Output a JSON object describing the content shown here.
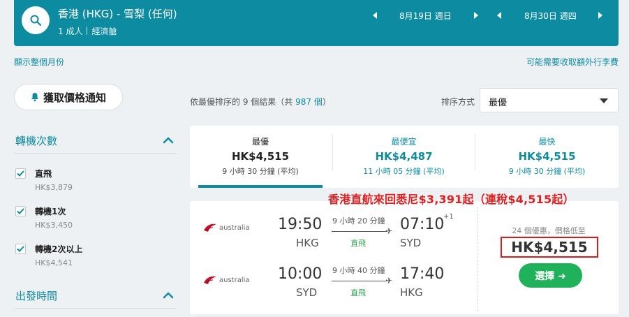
{
  "header": {
    "route": "香港 (HKG) - 雪梨 (任何)",
    "passengers": "1 成人",
    "cabin": "經濟艙",
    "depart_date": "8月19日 週日",
    "return_date": "8月30日 週四"
  },
  "links": {
    "show_month": "顯示整個月份",
    "baggage_fees": "可能需要收取額外行李費"
  },
  "sidebar": {
    "price_alert_label": "獲取價格通知",
    "stops_title": "轉機次數",
    "stops": [
      {
        "label": "直飛",
        "price": "HK$3,879",
        "checked": true
      },
      {
        "label": "轉機1次",
        "price": "HK$3,450",
        "checked": true
      },
      {
        "label": "轉機2次以上",
        "price": "HK$4,541",
        "checked": true
      }
    ],
    "departure_title": "出發時間"
  },
  "results": {
    "prefix": "依最優排序的 9 個結果（共 ",
    "total": "987 個",
    "suffix": "）",
    "sort_label": "排序方式",
    "sort_value": "最優"
  },
  "tabs": [
    {
      "title": "最優",
      "price": "HK$4,515",
      "duration": "9 小時 30 分鐘 (平均)",
      "selected": true
    },
    {
      "title": "最便宜",
      "price": "HK$4,487",
      "duration": "11 小時 05 分鐘 (平均)",
      "selected": false
    },
    {
      "title": "最快",
      "price": "HK$4,515",
      "duration": "9 小時 30 分鐘 (平均)",
      "selected": false
    }
  ],
  "promo_text": "香港直航來回悉尼$3,391起（連稅$4,515起）",
  "flight": {
    "legs": [
      {
        "airline": "australia",
        "depart_time": "19:50",
        "depart_code": "HKG",
        "duration": "9 小時 20 分鐘",
        "stops": "直飛",
        "arrive_time": "07:10",
        "day_offset": "+1",
        "arrive_code": "SYD"
      },
      {
        "airline": "australia",
        "depart_time": "10:00",
        "depart_code": "SYD",
        "duration": "9 小時 40 分鐘",
        "stops": "直飛",
        "arrive_time": "17:40",
        "day_offset": "",
        "arrive_code": "HKG"
      }
    ],
    "deals": "24 個優惠，價格低至",
    "price": "HK$4,515",
    "select_label": "選擇 ➜"
  },
  "colors": {
    "brand": "#0d8ba1",
    "nonstop": "#2aa44f",
    "cta": "#1fb25a",
    "promo": "#e02020",
    "highlight_box": "#d81c1c"
  }
}
